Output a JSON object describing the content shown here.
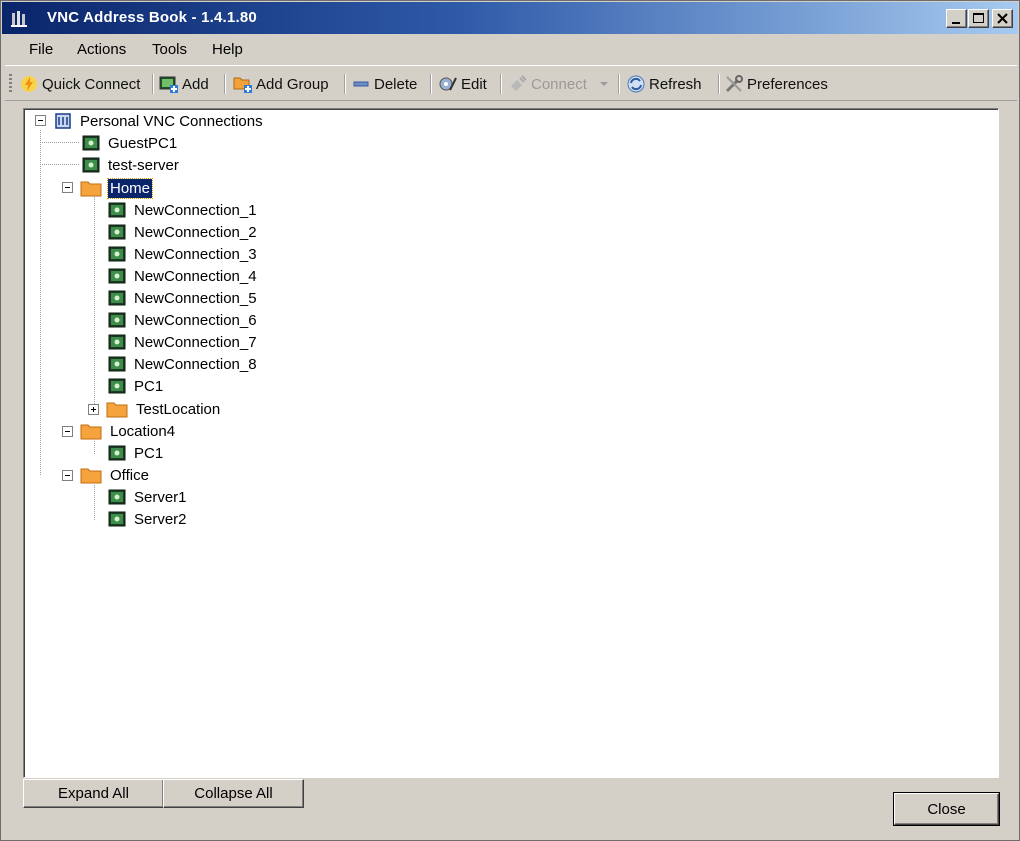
{
  "window": {
    "title": "VNC Address Book  -  1.4.1.80"
  },
  "menu": [
    "File",
    "Actions",
    "Tools",
    "Help"
  ],
  "toolbar": {
    "quick_connect": "Quick Connect",
    "add": "Add",
    "add_group": "Add Group",
    "delete": "Delete",
    "edit": "Edit",
    "connect": "Connect",
    "refresh": "Refresh",
    "preferences": "Preferences"
  },
  "tree": {
    "root": "Personal VNC Connections",
    "guest_pc1": "GuestPC1",
    "test_server": "test-server",
    "home": "Home",
    "home_connections": [
      "NewConnection_1",
      "NewConnection_2",
      "NewConnection_3",
      "NewConnection_4",
      "NewConnection_5",
      "NewConnection_6",
      "NewConnection_7",
      "NewConnection_8",
      "PC1"
    ],
    "test_location": "TestLocation",
    "location4": "Location4",
    "location4_pc1": "PC1",
    "office": "Office",
    "office_servers": [
      "Server1",
      "Server2"
    ]
  },
  "buttons": {
    "expand_all": "Expand All",
    "collapse_all": "Collapse All",
    "close": "Close"
  }
}
